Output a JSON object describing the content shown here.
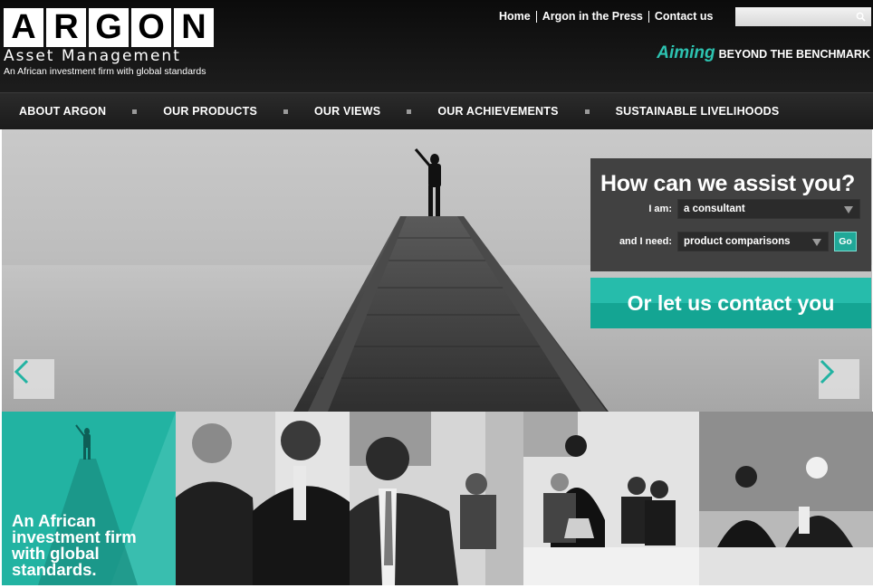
{
  "header": {
    "logo_letters": [
      "A",
      "R",
      "G",
      "O",
      "N"
    ],
    "logo_subtitle": "Asset Management",
    "logo_tagline": "An African investment firm with global standards",
    "top_links": [
      "Home",
      "Argon in the Press",
      "Contact us"
    ],
    "search_placeholder": "",
    "slogan_highlight": "Aiming",
    "slogan_rest": "BEYOND THE BENCHMARK"
  },
  "main_nav": [
    "ABOUT ARGON",
    "OUR PRODUCTS",
    "OUR VIEWS",
    "OUR ACHIEVEMENTS",
    "SUSTAINABLE LIVELIHOODS"
  ],
  "assist": {
    "title": "How can we assist you?",
    "iam_label": "I am:",
    "iam_value": "a consultant",
    "need_label": "and I need:",
    "need_value": "product comparisons",
    "go_label": "Go"
  },
  "contact_button": "Or let us contact you",
  "tiles": {
    "teal_text": "An African investment firm with global standards."
  },
  "colors": {
    "accent": "#22b3a2",
    "slogan_accent": "#2dc3b1",
    "header_bg": "#111111",
    "assist_bg": "#414141"
  },
  "icons": {
    "search": "search-icon",
    "prev": "chevron-left-icon",
    "next": "chevron-right-icon"
  }
}
